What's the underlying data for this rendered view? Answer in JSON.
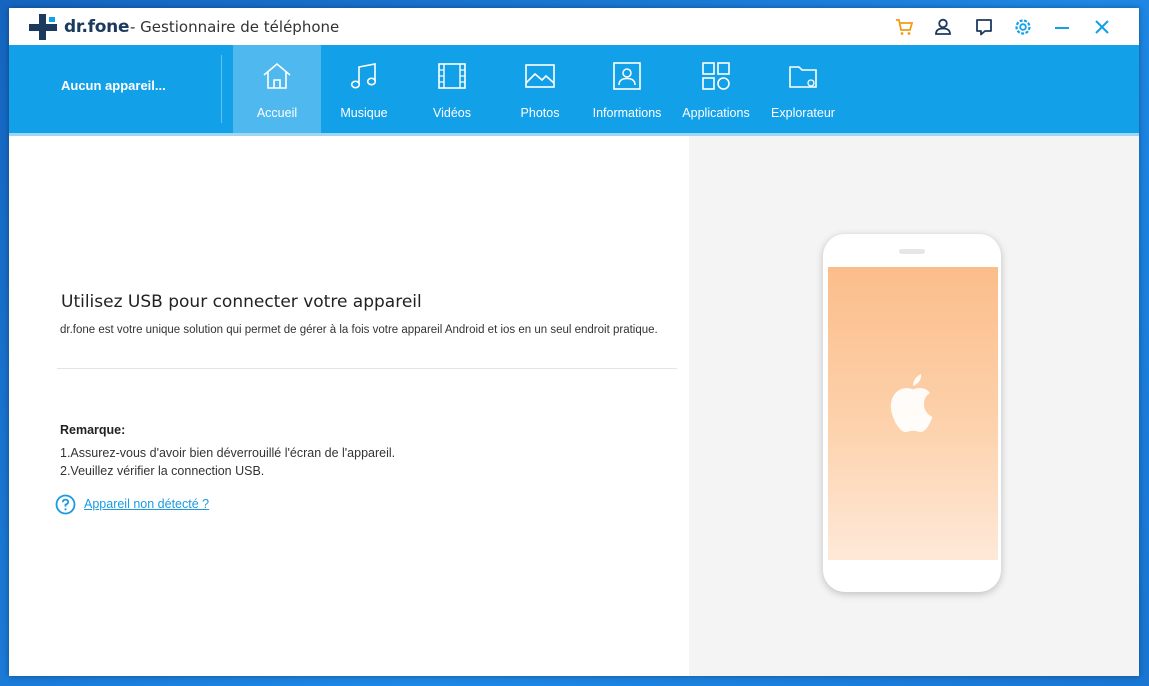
{
  "window": {
    "brand": "dr.fone",
    "title": "- Gestionnaire de téléphone"
  },
  "titlebar_icons": [
    "cart-icon",
    "user-icon",
    "feedback-icon",
    "settings-icon",
    "minimize-icon",
    "close-icon"
  ],
  "colors": {
    "accent": "#12a0e8",
    "active_tab": "#4fb8ee",
    "cart": "#f39c12",
    "link": "#1a9be0"
  },
  "toolbar": {
    "device": "Aucun appareil...",
    "tabs": [
      {
        "label": "Accueil",
        "icon": "home-icon",
        "active": true
      },
      {
        "label": "Musique",
        "icon": "music-icon",
        "active": false
      },
      {
        "label": "Vidéos",
        "icon": "video-icon",
        "active": false
      },
      {
        "label": "Photos",
        "icon": "photo-icon",
        "active": false
      },
      {
        "label": "Informations",
        "icon": "contact-icon",
        "active": false
      },
      {
        "label": "Applications",
        "icon": "apps-icon",
        "active": false
      },
      {
        "label": "Explorateur",
        "icon": "folder-icon",
        "active": false
      }
    ]
  },
  "main": {
    "heading": "Utilisez USB pour connecter votre appareil",
    "description": "dr.fone est votre unique solution  qui permet de gérer à la fois votre appareil Android et ios en un seul endroit pratique.",
    "remark_title": "Remarque:",
    "notes": [
      "1.Assurez-vous d'avoir bien déverrouillé l'écran de l'appareil.",
      "2.Veuillez vérifier la connection USB."
    ],
    "help_link": "Appareil non détecté ?"
  }
}
